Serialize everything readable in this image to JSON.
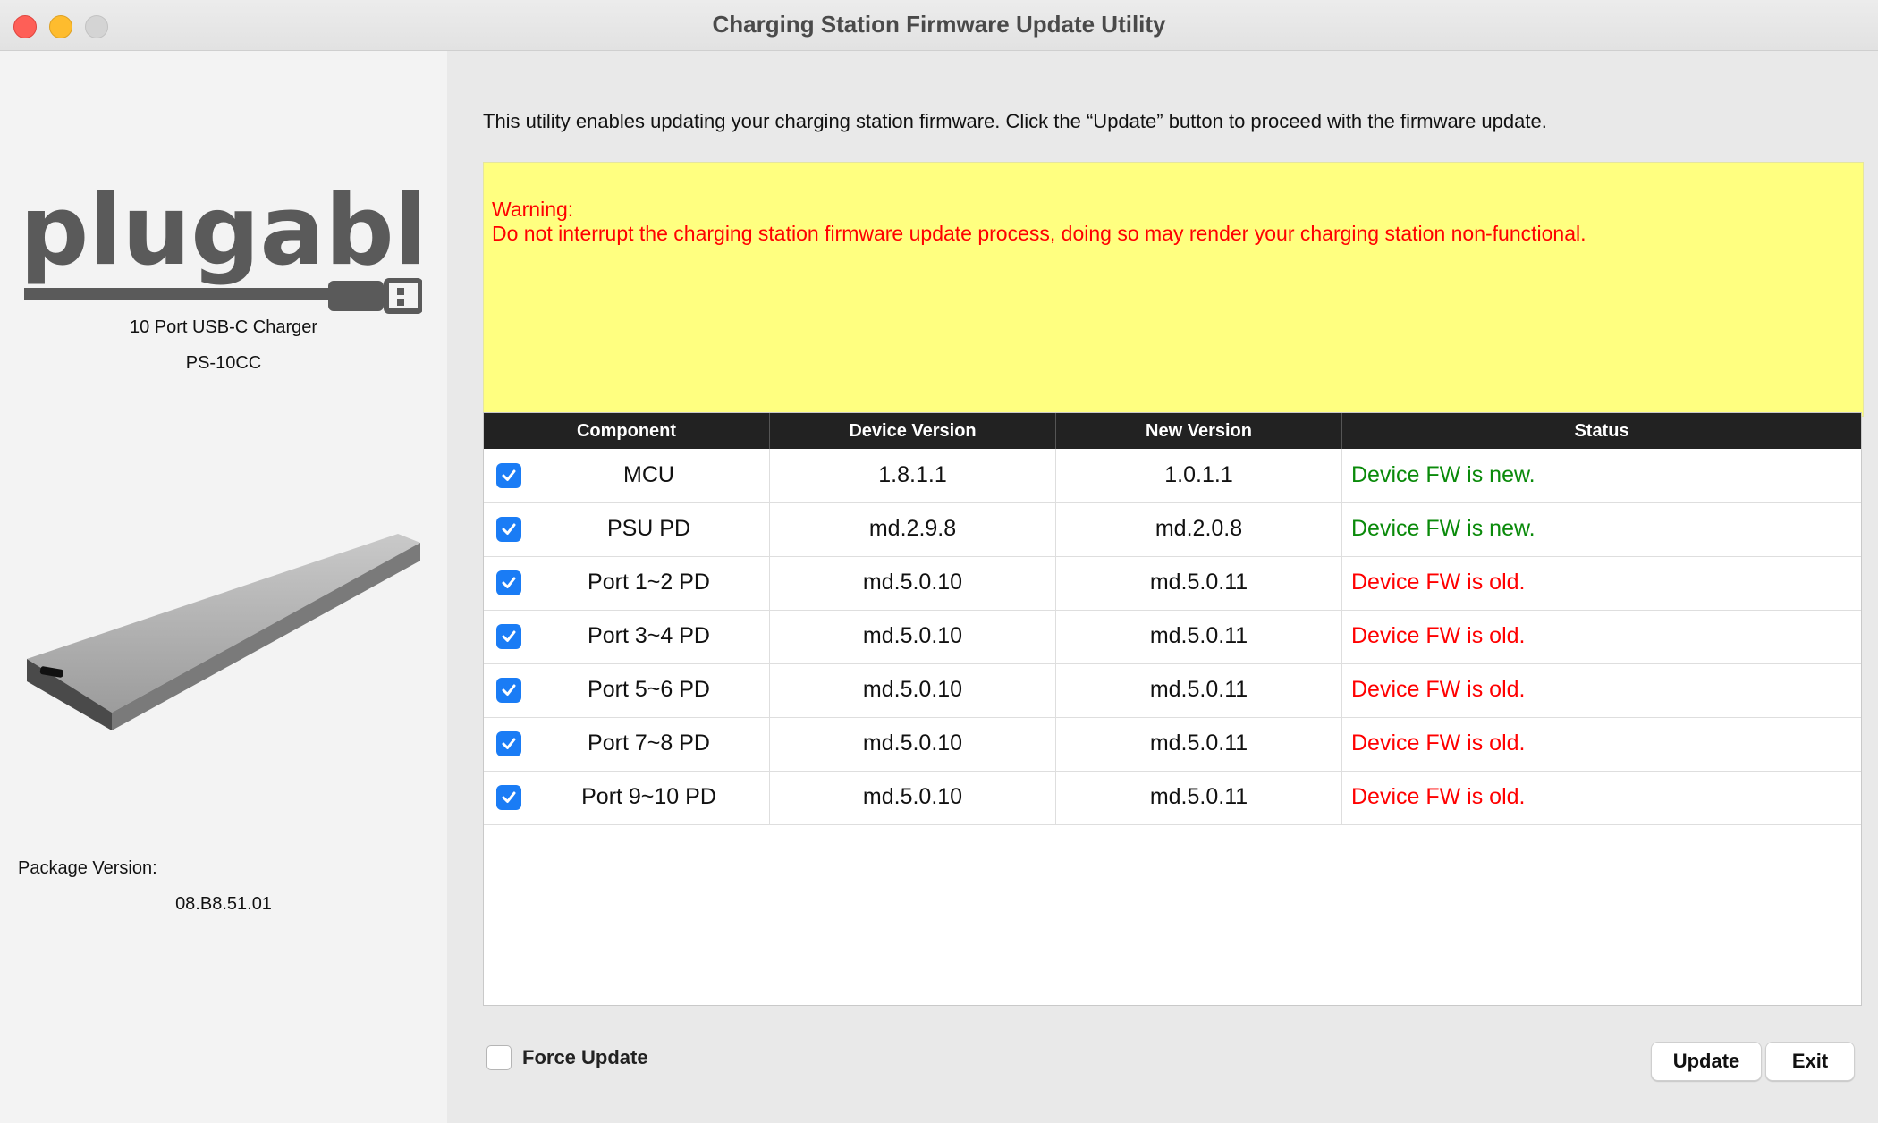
{
  "window": {
    "title": "Charging Station Firmware Update Utility"
  },
  "sidebar": {
    "logo_text": "plugable",
    "product_name": "10 Port USB-C Charger",
    "product_model": "PS-10CC",
    "package_label": "Package Version:",
    "package_value": "08.B8.51.01"
  },
  "main": {
    "intro": "This utility enables updating your charging station firmware. Click the “Update” button to proceed with the firmware update.",
    "warning": {
      "title": "Warning:",
      "text": "Do not interrupt the charging station firmware update process, doing so may render your charging station non-functional."
    }
  },
  "table": {
    "headers": [
      "Component",
      "Device Version",
      "New Version",
      "Status"
    ],
    "rows": [
      {
        "component": "MCU",
        "device": "1.8.1.1",
        "new": "1.0.1.1",
        "status": "Device FW is new.",
        "checked": true,
        "status_color": "#0a8a0a"
      },
      {
        "component": "PSU PD",
        "device": "md.2.9.8",
        "new": "md.2.0.8",
        "status": "Device FW is new.",
        "checked": true,
        "status_color": "#0a8a0a"
      },
      {
        "component": "Port 1~2 PD",
        "device": "md.5.0.10",
        "new": "md.5.0.11",
        "status": "Device FW is old.",
        "checked": true,
        "status_color": "#ff0000"
      },
      {
        "component": "Port 3~4 PD",
        "device": "md.5.0.10",
        "new": "md.5.0.11",
        "status": "Device FW is old.",
        "checked": true,
        "status_color": "#ff0000"
      },
      {
        "component": "Port 5~6 PD",
        "device": "md.5.0.10",
        "new": "md.5.0.11",
        "status": "Device FW is old.",
        "checked": true,
        "status_color": "#ff0000"
      },
      {
        "component": "Port 7~8 PD",
        "device": "md.5.0.10",
        "new": "md.5.0.11",
        "status": "Device FW is old.",
        "checked": true,
        "status_color": "#ff0000"
      },
      {
        "component": "Port 9~10 PD",
        "device": "md.5.0.10",
        "new": "md.5.0.11",
        "status": "Device FW is old.",
        "checked": true,
        "status_color": "#ff0000"
      }
    ]
  },
  "footer": {
    "force_update_label": "Force Update",
    "force_update_checked": false,
    "update_label": "Update",
    "exit_label": "Exit"
  },
  "colors": {
    "accent": "#1a7cf5",
    "warning_bg": "#ffff80",
    "warning_text": "#ff0000",
    "header_bg": "#222222",
    "logo_gray": "#5a5a5a",
    "logo_green": "#1e6b3a"
  }
}
